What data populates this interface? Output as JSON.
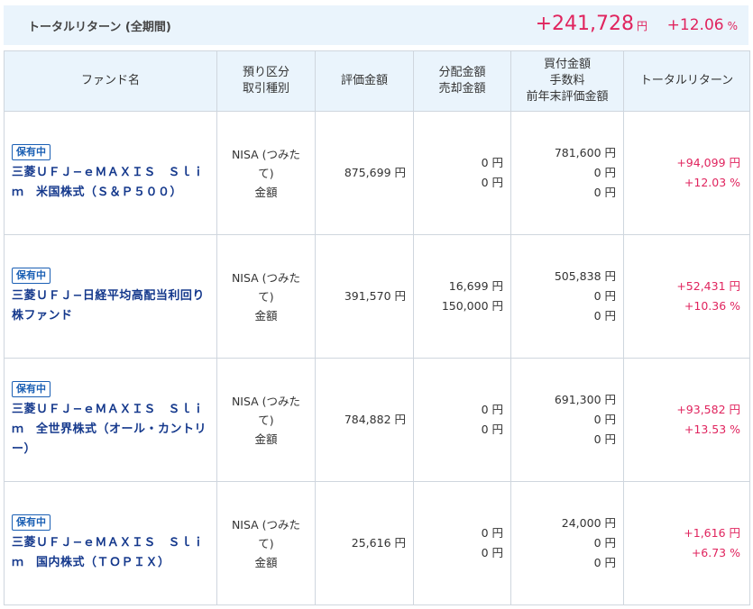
{
  "summary": {
    "label": "トータルリターン (全期間)",
    "amount": "+241,728",
    "yen": "円",
    "percent": "+12.06",
    "percent_sign": "%"
  },
  "headers": {
    "fund": "ファンド名",
    "account_1": "預り区分",
    "account_2": "取引種別",
    "valuation": "評価金額",
    "dist_1": "分配金額",
    "dist_2": "売却金額",
    "buy_1": "買付金額",
    "buy_2": "手数料",
    "buy_3": "前年末評価金額",
    "total_return": "トータルリターン"
  },
  "rows": [
    {
      "badge": "保有中",
      "name": "三菱ＵＦＪ−ｅＭＡＸＩＳ　Ｓｌｉｍ　米国株式（Ｓ＆Ｐ５００）",
      "account": "NISA (つみたて)",
      "trade_type": "金額",
      "valuation": "875,699 円",
      "distribution": "0 円",
      "sale": "0 円",
      "purchase": "781,600 円",
      "fee": "0 円",
      "prev_year_value": "0 円",
      "return_amount": "+94,099 円",
      "return_pct": "+12.03 %"
    },
    {
      "badge": "保有中",
      "name": "三菱ＵＦＪ−日経平均高配当利回り株ファンド",
      "account": "NISA (つみたて)",
      "trade_type": "金額",
      "valuation": "391,570 円",
      "distribution": "16,699 円",
      "sale": "150,000 円",
      "purchase": "505,838 円",
      "fee": "0 円",
      "prev_year_value": "0 円",
      "return_amount": "+52,431 円",
      "return_pct": "+10.36 %"
    },
    {
      "badge": "保有中",
      "name": "三菱ＵＦＪ−ｅＭＡＸＩＳ　Ｓｌｉｍ　全世界株式（オール・カントリー）",
      "account": "NISA (つみたて)",
      "trade_type": "金額",
      "valuation": "784,882 円",
      "distribution": "0 円",
      "sale": "0 円",
      "purchase": "691,300 円",
      "fee": "0 円",
      "prev_year_value": "0 円",
      "return_amount": "+93,582 円",
      "return_pct": "+13.53 %"
    },
    {
      "badge": "保有中",
      "name": "三菱ＵＦＪ−ｅＭＡＸＩＳ　Ｓｌｉｍ　国内株式（ＴＯＰＩＸ）",
      "account": "NISA (つみたて)",
      "trade_type": "金額",
      "valuation": "25,616 円",
      "distribution": "0 円",
      "sale": "0 円",
      "purchase": "24,000 円",
      "fee": "0 円",
      "prev_year_value": "0 円",
      "return_amount": "+1,616 円",
      "return_pct": "+6.73 %"
    }
  ],
  "colors": {
    "accent_positive": "#e0245e",
    "fund_link": "#14388c",
    "header_bg": "#eaf4fc",
    "badge": "#1a5fb4"
  }
}
